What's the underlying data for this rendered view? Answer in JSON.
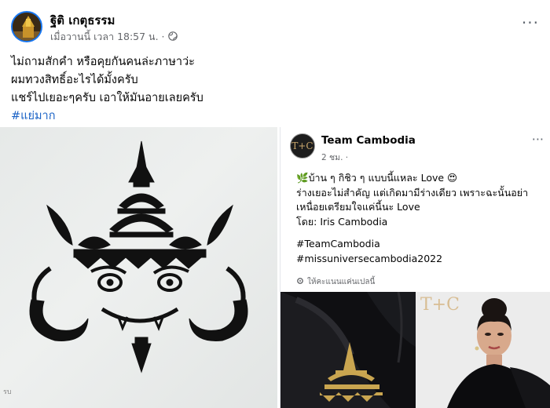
{
  "post": {
    "author": "ฐิติ เกตุธรรม",
    "time": "เมื่อวานนี้ เวลา 18:57 น. ·",
    "privacy_icon": "globe-icon",
    "more": "···",
    "text_lines": [
      "ไม่ถามสักคำ หรือคุยกันคนล่ะภาษาว่ะ",
      "ผมทวงสิทธิ์อะไรได้มั้งครับ",
      "แชร์ไปเยอะๆครับ เอาให้มันอายเลยครับ"
    ],
    "hashtag": "#แย่มาก"
  },
  "shared_post": {
    "avatar_text": "T+C",
    "name": "Team Cambodia",
    "time": "2 ชม. ·",
    "more": "···",
    "lines": [
      "🌿บ้าน ๆ กิชิว ๆ แบบนี้แหละ Love 😍",
      "ร่างเยอะไม่สำคัญ แต่เกิดมามีร่างเดียว เพราะฉะนั้นอย่า",
      "เหนื่อยเตรียมใจแค่นี้นะ Love",
      "โดย: Iris Cambodia"
    ],
    "tags": [
      "#TeamCambodia",
      "#missuniversecambodia2022"
    ],
    "footer": "ให้คะแนนแค่นเปลนี้",
    "photo_watermark": "T+C"
  },
  "colors": {
    "accent": "#1877f2",
    "hashtag": "#1a62c6",
    "meta": "#65676b",
    "gold": "#d6b98a"
  }
}
